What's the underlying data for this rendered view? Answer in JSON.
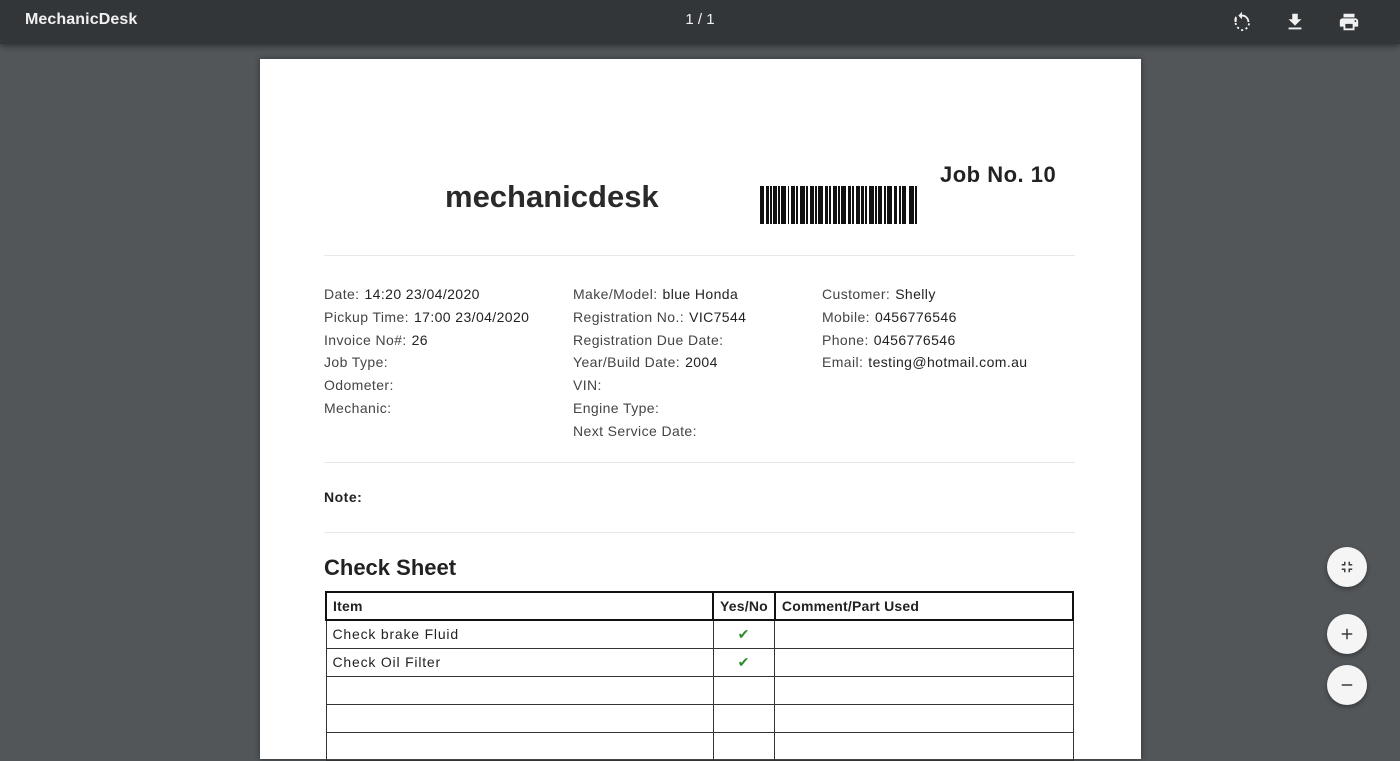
{
  "toolbar": {
    "app_title": "MechanicDesk",
    "page_indicator": "1 / 1",
    "icons": [
      "rotate-icon",
      "download-icon",
      "print-icon"
    ]
  },
  "document": {
    "brand": "mechanicdesk",
    "job_number": "Job No. 10",
    "job_info": [
      {
        "label": "Date:",
        "value": "14:20 23/04/2020"
      },
      {
        "label": "Pickup Time:",
        "value": "17:00 23/04/2020"
      },
      {
        "label": "Invoice No#:",
        "value": "26"
      },
      {
        "label": "Job Type:",
        "value": ""
      },
      {
        "label": "Odometer:",
        "value": ""
      },
      {
        "label": "Mechanic:",
        "value": ""
      }
    ],
    "vehicle_info": [
      {
        "label": "Make/Model:",
        "value": "blue Honda"
      },
      {
        "label": "Registration No.:",
        "value": "VIC7544"
      },
      {
        "label": "Registration Due Date:",
        "value": ""
      },
      {
        "label": "Year/Build Date:",
        "value": "2004"
      },
      {
        "label": "VIN:",
        "value": ""
      },
      {
        "label": "Engine Type:",
        "value": ""
      },
      {
        "label": "Next Service Date:",
        "value": ""
      }
    ],
    "customer_info": [
      {
        "label": "Customer:",
        "value": "Shelly"
      },
      {
        "label": "Mobile:",
        "value": "0456776546"
      },
      {
        "label": "Phone:",
        "value": "0456776546"
      },
      {
        "label": "Email:",
        "value": "testing@hotmail.com.au"
      }
    ],
    "note_label": "Note:",
    "check_sheet": {
      "title": "Check Sheet",
      "headers": [
        "Item",
        "Yes/No",
        "Comment/Part Used"
      ],
      "rows": [
        {
          "item": "Check brake Fluid",
          "yes_no": "✔",
          "comment": ""
        },
        {
          "item": "Check Oil Filter",
          "yes_no": "✔",
          "comment": ""
        },
        {
          "item": "",
          "yes_no": "",
          "comment": ""
        },
        {
          "item": "",
          "yes_no": "",
          "comment": ""
        },
        {
          "item": "",
          "yes_no": "",
          "comment": ""
        }
      ]
    }
  },
  "viewer_controls": {
    "icons": [
      "fit-page-icon",
      "zoom-in-icon",
      "zoom-out-icon"
    ]
  }
}
